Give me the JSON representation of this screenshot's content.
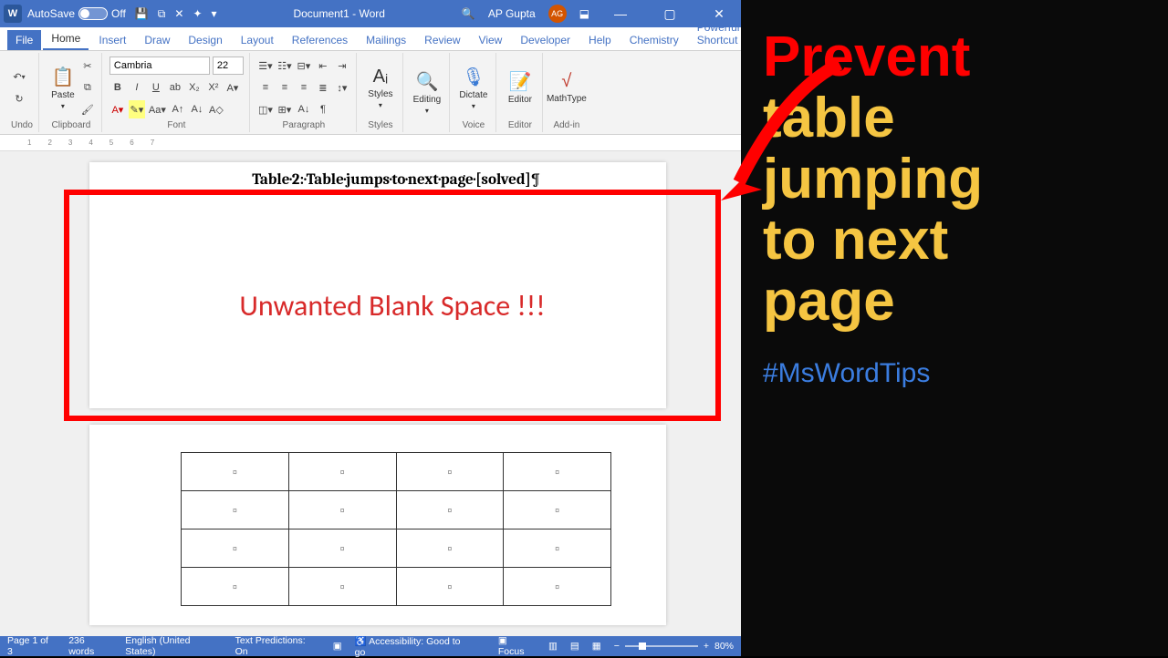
{
  "titlebar": {
    "autosave_label": "AutoSave",
    "autosave_state": "Off",
    "document_title": "Document1 - Word",
    "user_name": "AP Gupta",
    "user_initials": "AG"
  },
  "tabs": [
    "File",
    "Home",
    "Insert",
    "Draw",
    "Design",
    "Layout",
    "References",
    "Mailings",
    "Review",
    "View",
    "Developer",
    "Help",
    "Chemistry",
    "Powerful Shortcut"
  ],
  "active_tab": "Home",
  "ribbon": {
    "undo_label": "Undo",
    "clipboard_label": "Clipboard",
    "paste_label": "Paste",
    "font_label": "Font",
    "font_name": "Cambria",
    "font_size": "22",
    "paragraph_label": "Paragraph",
    "styles_label": "Styles",
    "styles_btn": "Styles",
    "editing_label": "Editing",
    "editing_btn": "Editing",
    "voice_label": "Voice",
    "dictate_btn": "Dictate",
    "editor_label": "Editor",
    "editor_btn": "Editor",
    "addin_label": "Add-in",
    "mathtype_btn": "MathType"
  },
  "document": {
    "heading": "Table·2:·Table·jumps·to·next·page·[solved]¶",
    "annotation": "Unwanted Blank Space !!!",
    "table_rows": 4,
    "table_cols": 4
  },
  "statusbar": {
    "page": "Page 1 of 3",
    "words": "236 words",
    "language": "English (United States)",
    "predictions": "Text Predictions: On",
    "accessibility": "Accessibility: Good to go",
    "focus": "Focus",
    "zoom": "80%"
  },
  "side_panel": {
    "line1": "Prevent",
    "line2": "table",
    "line3": "jumping",
    "line4": "to next",
    "line5": "page",
    "hashtag": "#MsWordTips"
  }
}
